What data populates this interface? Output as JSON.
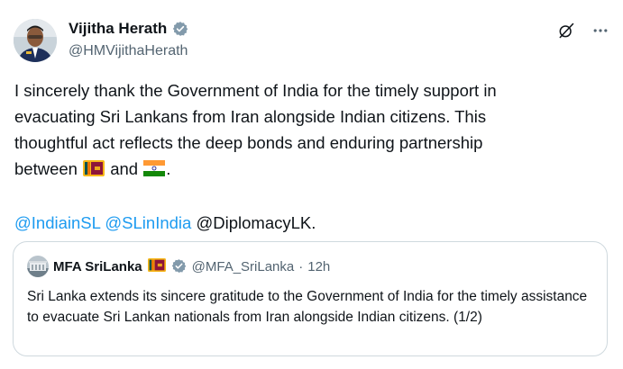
{
  "tweet": {
    "author_name": "Vijitha Herath",
    "author_handle": "@HMVijithaHerath",
    "text_line1": "I sincerely thank the Government of India for the timely support in",
    "text_line2": "evacuating Sri Lankans from Iran alongside Indian citizens. This",
    "text_line3": "thoughtful act reflects the deep bonds and enduring partnership",
    "text_line4_pre": "between ",
    "text_line4_mid": " and ",
    "text_line4_post": ".",
    "mention1": "@IndiainSL",
    "mention2": "@SLinIndia",
    "mention3": "@DiplomacyLK."
  },
  "quote": {
    "author_name": "MFA SriLanka",
    "author_handle": "@MFA_SriLanka",
    "separator": "·",
    "time": "12h",
    "text": "Sri Lanka extends its sincere gratitude to the Government of India for the timely assistance  to evacuate Sri Lankan nationals from Iran alongside Indian citizens. (1/2)"
  },
  "icons": {
    "verified": "verified-badge-icon",
    "grok": "grok-icon",
    "more": "more-icon",
    "flag_sri_lanka": "sri-lanka-flag",
    "flag_india": "india-flag"
  },
  "colors": {
    "link": "#1d9bf0",
    "secondary_text": "#536471",
    "border": "#cfd9de",
    "verified": "#829aab"
  }
}
